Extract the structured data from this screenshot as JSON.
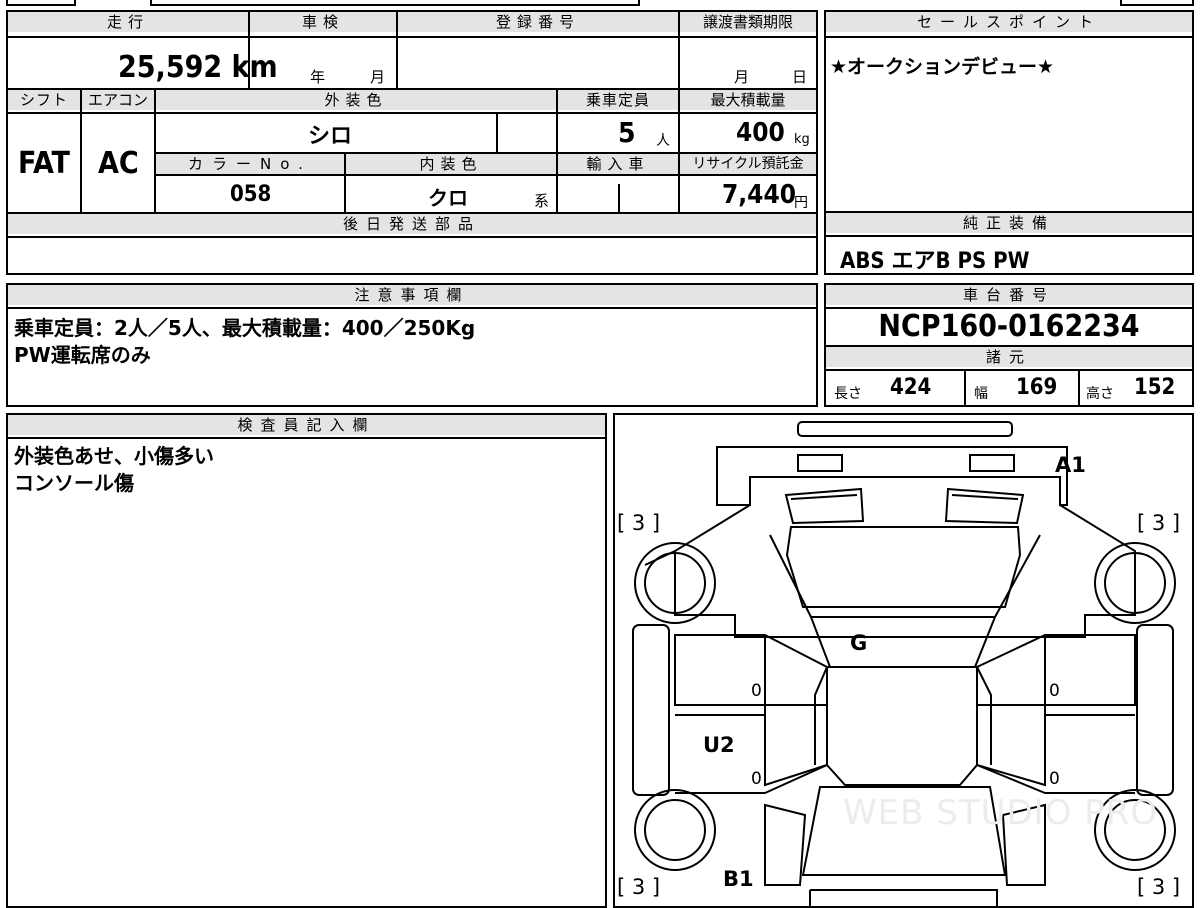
{
  "spec": {
    "mileage_header": "走行",
    "mileage_value": "25,592",
    "mileage_unit": "km",
    "shaken_header": "車検",
    "shaken_year": "年",
    "shaken_month": "月",
    "reg_header": "登録番号",
    "doc_deadline_header": "譲渡書類期限",
    "doc_month": "月",
    "doc_day": "日",
    "shift_header": "シフト",
    "shift_value": "FAT",
    "ac_header": "エアコン",
    "ac_value": "AC",
    "exterior_color_header": "外装色",
    "exterior_color_value": "シロ",
    "capacity_header": "乗車定員",
    "capacity_value": "5",
    "capacity_unit": "人",
    "max_load_header": "最大積載量",
    "max_load_value": "400",
    "max_load_unit": "kg",
    "color_no_header": "カラーNo.",
    "color_no_value": "058",
    "interior_color_header": "内装色",
    "interior_color_value": "クロ",
    "interior_color_suffix": "系",
    "import_header": "輸入車",
    "recycle_header": "リサイクル預託金",
    "recycle_value": "7,440",
    "recycle_unit": "円",
    "later_parts_header": "後日発送部品"
  },
  "sales": {
    "header": "セールスポイント",
    "text": "★オークションデビュー★"
  },
  "equipment": {
    "header": "純正装備",
    "text": "ABS エアB PS PW"
  },
  "caution": {
    "header": "注意事項欄",
    "line1": "乗車定員：2人／5人、最大積載量：400／250Kg",
    "line2": "PW運転席のみ"
  },
  "chassis": {
    "header": "車台番号",
    "value": "NCP160-0162234"
  },
  "dimensions": {
    "header": "諸元",
    "length_label": "長さ",
    "length_value": "424",
    "width_label": "幅",
    "width_value": "169",
    "height_label": "高さ",
    "height_value": "152"
  },
  "inspector": {
    "header": "検査員記入欄",
    "line1": "外装色あせ、小傷多い",
    "line2": "コンソール傷"
  },
  "diagram": {
    "tyre_front_left": "[ 3 ]",
    "tyre_front_right": "[ 3 ]",
    "tyre_rear_left": "[ 3 ]",
    "tyre_rear_right": "[ 3 ]",
    "mark_a1": "A1",
    "mark_g": "G",
    "mark_u2": "U2",
    "mark_b1": "B1",
    "zero_1": "0",
    "zero_2": "0",
    "zero_3": "0",
    "zero_4": "0",
    "watermark": "WEB STUDIO PRO"
  }
}
